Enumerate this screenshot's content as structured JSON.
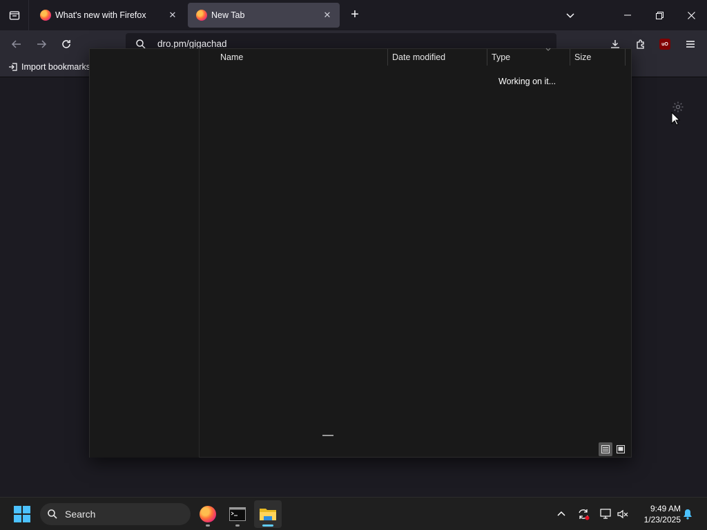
{
  "browser": {
    "tabs": [
      {
        "label": "What's new with Firefox",
        "active": false
      },
      {
        "label": "New Tab",
        "active": true
      }
    ],
    "url": "dro.pm/gigachad",
    "bookmarks": {
      "import_label": "Import bookmarks"
    }
  },
  "file_dialog": {
    "columns": [
      "Name",
      "Date modified",
      "Type",
      "Size"
    ],
    "status": "Working on it...",
    "view_buttons": [
      "details-view",
      "large-icons-view"
    ]
  },
  "taskbar": {
    "search_label": "Search",
    "apps": [
      "firefox",
      "terminal",
      "file-explorer"
    ],
    "active_app": "file-explorer",
    "time": "9:49 AM",
    "date": "1/23/2025"
  },
  "colors": {
    "accent": "#60cdff",
    "browser_bg": "#1c1b22",
    "toolbar_bg": "#2b2a33",
    "dialog_bg": "#191919"
  }
}
